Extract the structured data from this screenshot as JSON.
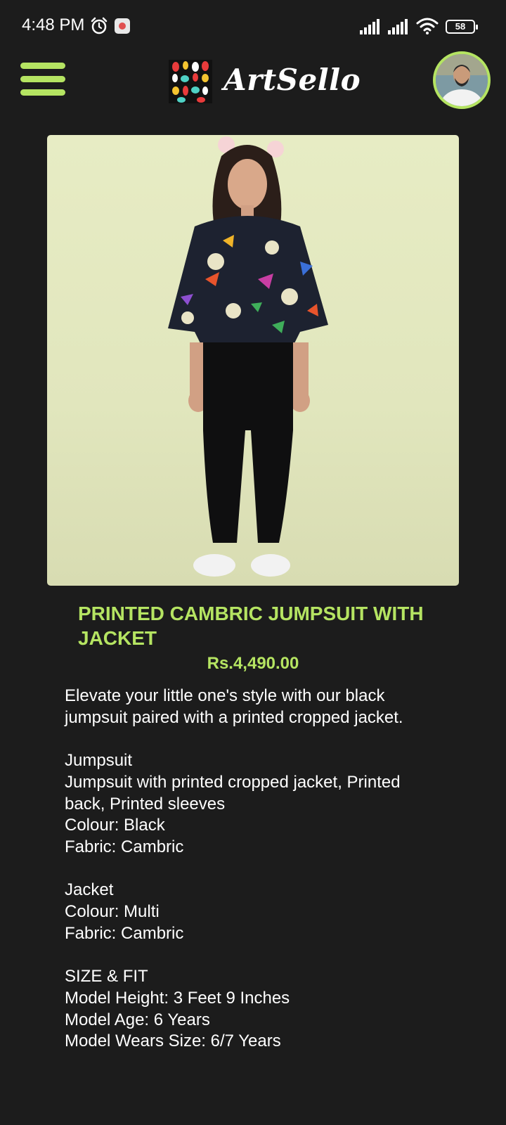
{
  "status_bar": {
    "time": "4:48 PM",
    "battery": "58"
  },
  "header": {
    "brand": "ArtSello"
  },
  "product": {
    "title": "PRINTED CAMBRIC JUMPSUIT WITH JACKET",
    "price": "Rs.4,490.00",
    "intro": [
      "Elevate your little one's style with our black",
      "jumpsuit paired with a printed cropped jacket."
    ],
    "jumpsuit": {
      "heading": "Jumpsuit",
      "lines": [
        "Jumpsuit with printed cropped jacket, Printed",
        "back, Printed sleeves",
        "Colour: Black",
        "Fabric: Cambric"
      ]
    },
    "jacket": {
      "heading": "Jacket",
      "lines": [
        "Colour: Multi",
        "Fabric: Cambric"
      ]
    },
    "size_fit": {
      "heading": "SIZE & FIT",
      "lines": [
        "Model Height: 3 Feet 9 Inches",
        "Model Age: 6 Years",
        "Model Wears Size: 6/7 Years"
      ]
    }
  },
  "colors": {
    "accent": "#b5e462",
    "background": "#1c1c1c",
    "text": "#ffffff"
  },
  "icons": [
    "alarm-icon",
    "notification-icon",
    "signal-icon",
    "wifi-icon",
    "battery-icon",
    "menu-icon",
    "brand-logo",
    "avatar"
  ]
}
